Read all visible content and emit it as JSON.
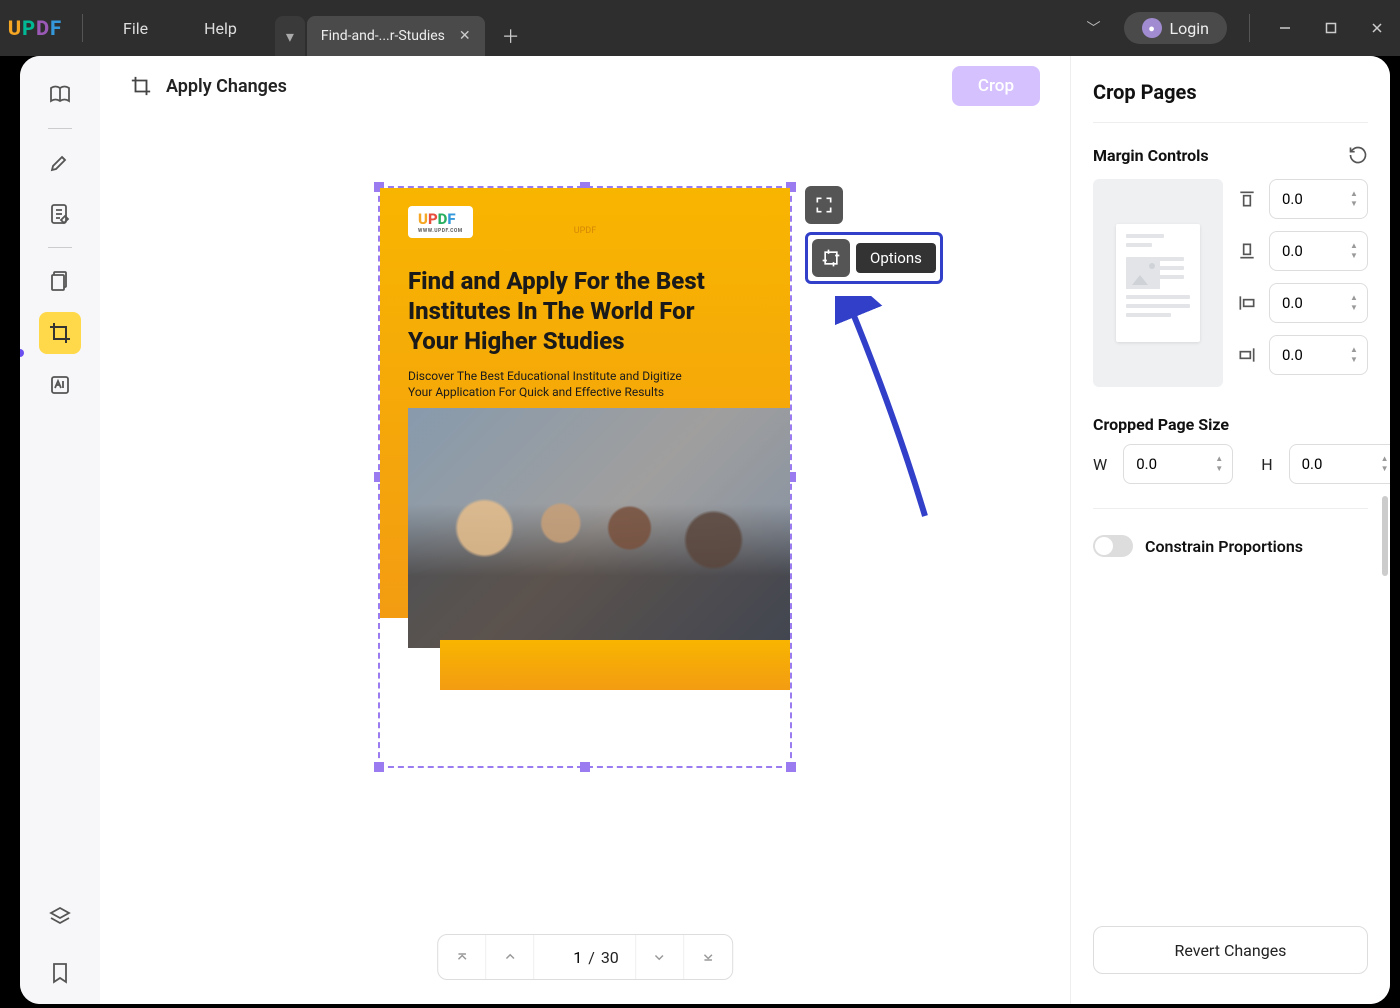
{
  "menu": {
    "file": "File",
    "help": "Help"
  },
  "tab": {
    "title": "Find-and-...r-Studies"
  },
  "login": "Login",
  "header": {
    "apply": "Apply Changes",
    "crop": "Crop"
  },
  "document": {
    "watermark": "UPDF",
    "badge_sub": "WWW.UPDF.COM",
    "title": "Find and Apply For the Best Institutes In The World For Your Higher Studies",
    "subtitle": "Discover The Best Educational Institute and Digitize Your Application For Quick and Effective Results"
  },
  "options_tooltip": "Options",
  "pager": {
    "current": "1",
    "sep": "/",
    "total": "30"
  },
  "panel": {
    "title": "Crop Pages",
    "margin_title": "Margin Controls",
    "margins": {
      "top": "0.0",
      "bottom": "0.0",
      "left": "0.0",
      "right": "0.0"
    },
    "size_title": "Cropped Page Size",
    "w_label": "W",
    "h_label": "H",
    "w": "0.0",
    "h": "0.0",
    "constrain": "Constrain Proportions",
    "revert": "Revert Changes"
  }
}
